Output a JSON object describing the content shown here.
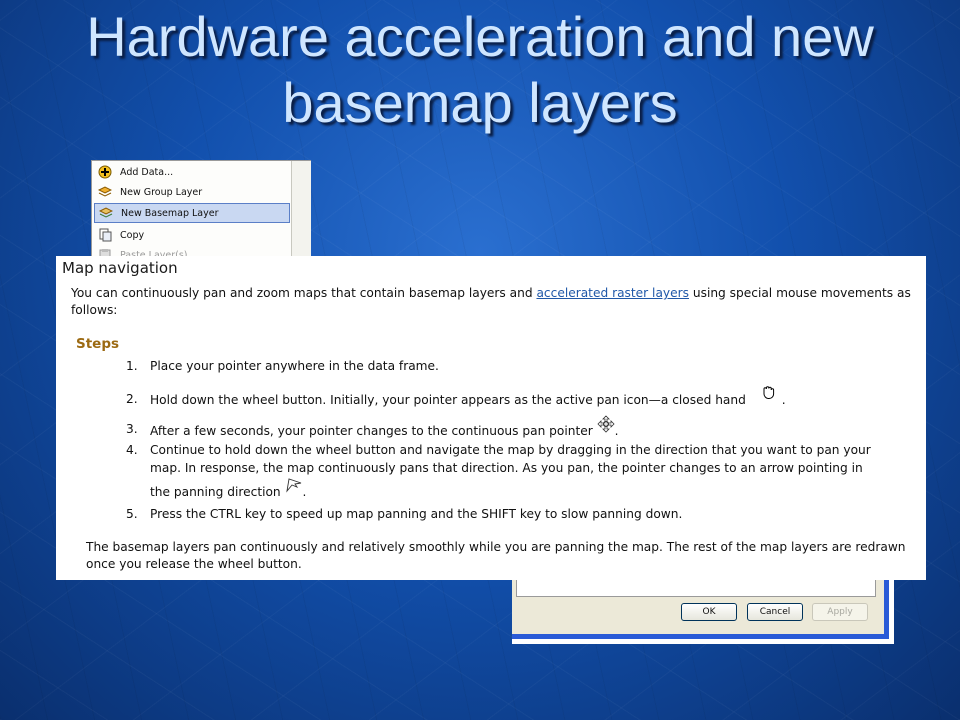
{
  "slide": {
    "title_line1": "Hardware acceleration and new",
    "title_line2": "basemap layers"
  },
  "context_menu": {
    "items": [
      {
        "label": "Add Data...",
        "icon": "add-data-icon"
      },
      {
        "label": "New Group Layer",
        "icon": "group-layer-icon"
      },
      {
        "label": "New Basemap Layer",
        "icon": "basemap-layer-icon",
        "selected": true
      },
      {
        "label": "Copy",
        "icon": "copy-icon"
      },
      {
        "label": "Paste Layer(s)",
        "icon": "paste-icon"
      }
    ]
  },
  "dialog": {
    "ok_label": "OK",
    "cancel_label": "Cancel",
    "apply_label": "Apply"
  },
  "help": {
    "title": "Map navigation",
    "intro_before": "You can continuously pan and zoom maps that contain basemap layers and ",
    "intro_link": "accelerated raster layers",
    "intro_after": " using special mouse movements as follows:",
    "steps_heading": "Steps",
    "steps": [
      {
        "num": "1.",
        "text": "Place your pointer anywhere in the data frame."
      },
      {
        "num": "2.",
        "text": "Hold down the wheel button. Initially, your pointer appears as the active pan icon—a closed hand",
        "suffix": "."
      },
      {
        "num": "3.",
        "text": "After a few seconds, your pointer changes to the continuous pan pointer",
        "suffix": "."
      },
      {
        "num": "4.",
        "line1": "Continue to hold down the wheel button and navigate the map by dragging in the direction that you want to pan your",
        "line2": "map. In response, the map continuously pans that direction. As you pan, the pointer changes to an arrow pointing in",
        "line3": "the panning direction",
        "suffix": "."
      },
      {
        "num": "5.",
        "text": "Press the CTRL key to speed up map panning and the SHIFT key to slow panning down."
      }
    ],
    "outro": "The basemap layers pan continuously and relatively smoothly while you are panning the map. The rest of the map layers are redrawn once you release the wheel button."
  },
  "colors": {
    "background": "#1250ad",
    "title": "#cfe6ff",
    "steps_heading": "#9c6a12",
    "link": "#2058a8"
  }
}
